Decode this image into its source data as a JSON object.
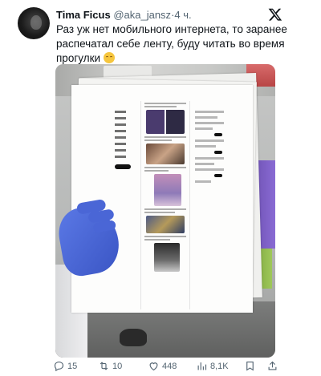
{
  "author": {
    "display_name": "Tima Ficus",
    "handle": "@aka_jansz",
    "separator": "·",
    "time": "4 ч."
  },
  "tweet": {
    "text": "Раз уж нет мобильного интернета, то заранее распечатал себе ленту, буду читать во время прогулки",
    "emoji": "relieved-face"
  },
  "media": {
    "description": "photo of hand in blue glove holding printed twitter feed pages"
  },
  "stats": {
    "replies": "15",
    "retweets": "10",
    "likes": "448",
    "views": "8,1K"
  },
  "icons": {
    "platform": "x-logo-icon",
    "reply": "reply-icon",
    "retweet": "retweet-icon",
    "like": "heart-icon",
    "views": "views-icon",
    "bookmark": "bookmark-icon",
    "share": "share-icon"
  },
  "colors": {
    "text": "#0f1419",
    "secondary": "#536471",
    "glove": "#4a66d6"
  }
}
